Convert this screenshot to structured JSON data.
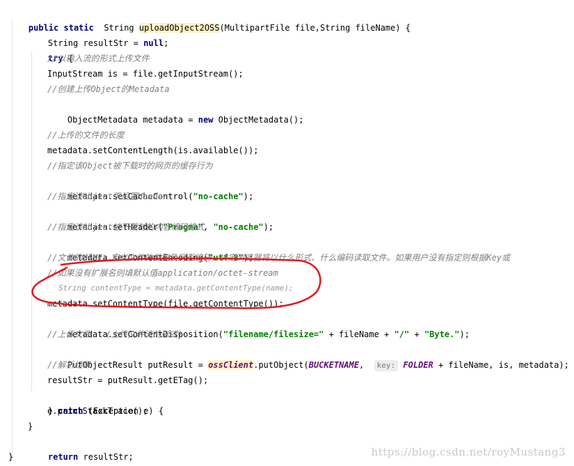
{
  "code": {
    "l01": {
      "kw1": "public",
      "kw2": "static",
      "type": "String",
      "method": "uploadObject2OSS",
      "params": "(MultipartFile file,String fileName) {"
    },
    "l02": {
      "pre": "String resultStr = ",
      "kw": "null",
      "post": ";"
    },
    "l03": {
      "kw": "try",
      "post": " {"
    },
    "l04": {
      "comment": "//以输入流的形式上传文件"
    },
    "l05": {
      "text": "InputStream is = file.getInputStream();"
    },
    "l06": {
      "comment": "//创建上传Object的Metadata"
    },
    "l07": {
      "pre": "ObjectMetadata metadata = ",
      "kw": "new",
      "post": " ObjectMetadata();"
    },
    "l08": {
      "comment": "//上传的文件的长度"
    },
    "l09": {
      "text": "metadata.setContentLength(is.available());"
    },
    "l10": {
      "comment": "//指定该Object被下载时的网页的缓存行为"
    },
    "l11": {
      "pre": "metadata.setCacheControl(",
      "str": "\"no-cache\"",
      "post": ");"
    },
    "l12": {
      "comment": "//指定该Object下设置Header"
    },
    "l13": {
      "pre": "metadata.setHeader(",
      "str1": "\"Pragma\"",
      "mid": ", ",
      "str2": "\"no-cache\"",
      "post": ");"
    },
    "l14": {
      "comment": "//指定该Object被下载时的内容编码格式"
    },
    "l15": {
      "pre": "metadata.setContentEncoding(",
      "str": "\"utf-8\"",
      "post": ");"
    },
    "l16": {
      "comment": "//文件的MIME，定义文件的类型及网页编码，决定浏览器将以什么形式、什么编码读取文件。如果用户没有指定则根据Key或"
    },
    "l17": {
      "comment": "//如果没有扩展名则填默认值application/octet-stream"
    },
    "l18": {
      "comment": "String contentType = metadata.getContentType(name);"
    },
    "l19": {
      "text": "metadata.setContentType(file.getContentType());"
    },
    "l20": {
      "pre": "metadata.setContentDisposition(",
      "str1": "\"filename/filesize=\"",
      "mid1": " + fileName + ",
      "str2": "\"/\"",
      "mid2": " + ",
      "str3": "\"Byte.\"",
      "post": ");"
    },
    "l21": {
      "comment": "//上传文件   (上传文件流的形式)"
    },
    "l22": {
      "pre": "PutObjectResult putResult = ",
      "field": "ossClient",
      "mid": ".putObject(",
      "const1": "BUCKETNAME",
      "sep": ", ",
      "hint": "key:",
      "const2": "FOLDER",
      "post": " + fileName, is, metadata);"
    },
    "l23": {
      "comment": "//解析结果"
    },
    "l24": {
      "text": "resultStr = putResult.getETag();"
    },
    "l25": {
      "pre": "} ",
      "kw": "catch",
      "post": " (Exception e) {"
    },
    "l26": {
      "text": "e.printStackTrace();"
    },
    "l27": {
      "text": "}"
    },
    "l28": {
      "kw": "return",
      "post": " resultStr;"
    },
    "l29": {
      "text": "}"
    }
  },
  "watermark": "https://blog.csdn.net/royMustang3",
  "colors": {
    "keyword": "#000080",
    "string": "#008000",
    "comment": "#808080",
    "constant": "#660e7a",
    "method_highlight": "#fff2c4",
    "annotation": "#e8141b"
  }
}
